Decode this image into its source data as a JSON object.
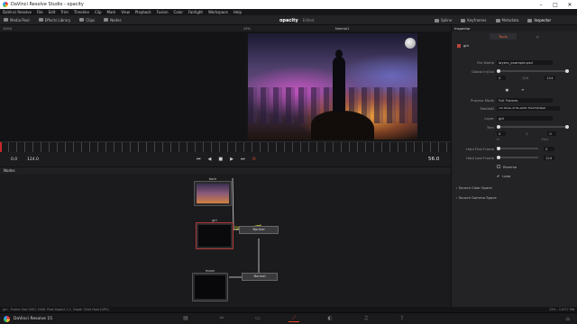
{
  "window": {
    "title": "DaVinci Resolve Studio - opacity"
  },
  "menu": [
    "DaVinci Resolve",
    "File",
    "Edit",
    "Trim",
    "Timeline",
    "Clip",
    "Mark",
    "View",
    "Playback",
    "Fusion",
    "Color",
    "Fairlight",
    "Workspace",
    "Help"
  ],
  "toolbar": {
    "media_pool": "Media Pool",
    "effects": "Effects Library",
    "clips": "Clips",
    "nodes": "Nodes",
    "project": "opacity",
    "status": "Edited",
    "spline": "Spline",
    "keyframes": "Keyframes",
    "metadata": "Metadata",
    "inspector": "Inspector"
  },
  "viewer": {
    "zoom": "100%",
    "zoom_right": "29%",
    "title": "Normal1"
  },
  "transport": {
    "start": "0.0",
    "end_field": "124.0",
    "current": "56.0"
  },
  "nodes_panel": {
    "title": "Nodes",
    "node_back": "back",
    "node_girl": "girl",
    "node_moon": "moon",
    "tool_normal1": "Normal",
    "tool_normal2": "Normal"
  },
  "inspector": {
    "title": "Inspector",
    "tab_tools": "Tools",
    "node_name": "girl",
    "file_name_label": "File Name",
    "file_name": "layers_example.psd",
    "global_label": "Global In/Out",
    "global_in": "0",
    "global_mid": "120",
    "global_out": "124",
    "process_label": "Process Mode",
    "process_value": "Full Frames",
    "mediaid_label": "MediaID",
    "mediaid_value": "c0c-8b4e-47db-a0d6-7fe97b6d6e0",
    "layer_label": "Layer",
    "layer_value": "girl",
    "trim_label": "Trim",
    "trim_in": "0",
    "trim_mid": "1",
    "trim_out": "0",
    "trim_in_label": "In",
    "trim_out_label": "End",
    "hold_first_label": "Hold First Frame",
    "hold_first_value": "0",
    "hold_last_label": "Hold Last Frame",
    "hold_last_value": "124",
    "reverse_label": "Reverse",
    "loop_label": "Loop",
    "source_color": "Source Color Space",
    "source_gamma": "Source Gamma Space"
  },
  "statusbar": {
    "left": "girl - Frame Size 0001 1948, Pixel Aspect 1:1, Depth 32bit float (GPU)",
    "right": "13% - 11977 MB"
  },
  "pagenav": {
    "brand": "DaVinci Resolve 15"
  }
}
